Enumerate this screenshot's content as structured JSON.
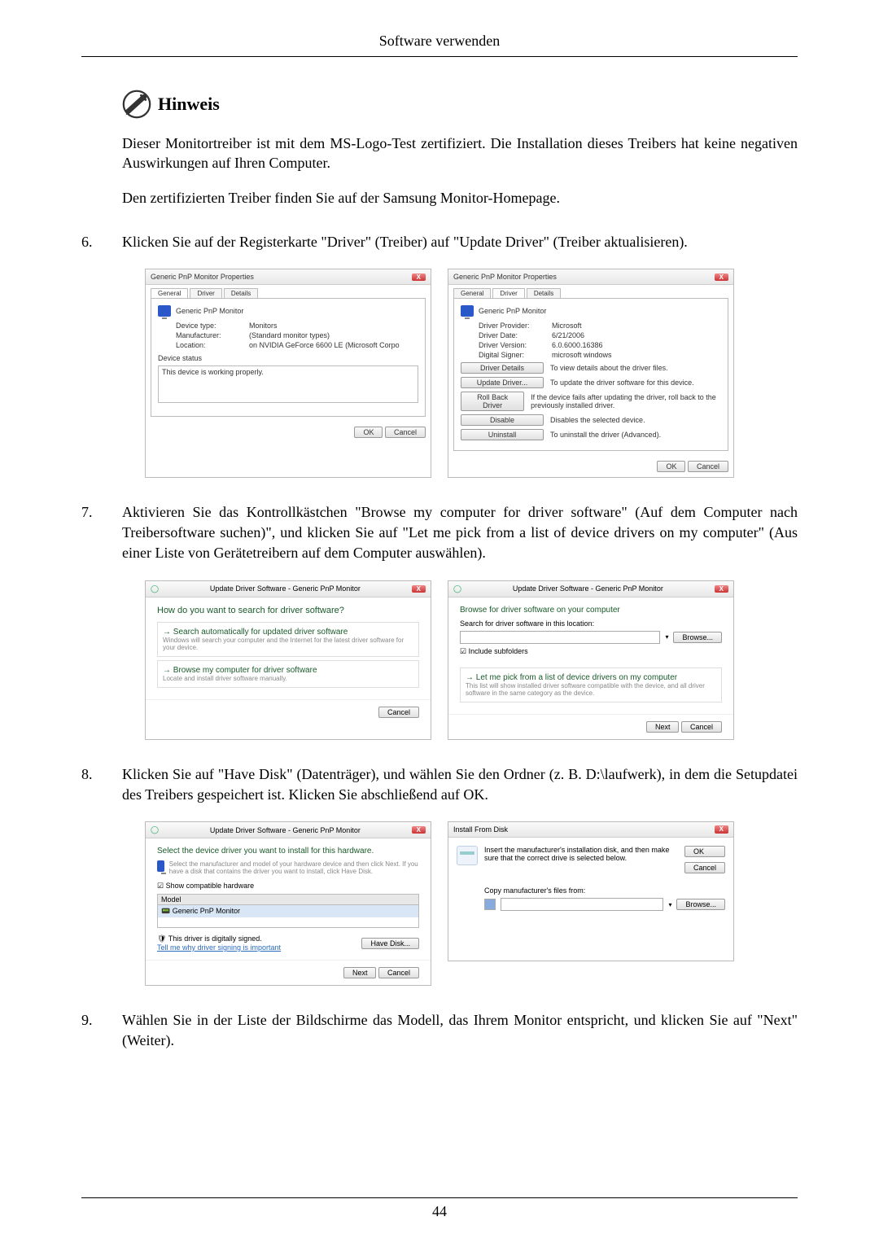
{
  "header": {
    "title": "Software verwenden"
  },
  "note": {
    "title": "Hinweis",
    "p1": "Dieser Monitortreiber ist mit dem MS-Logo-Test zertifiziert. Die Installation dieses Treibers hat keine negativen Auswirkungen auf Ihren Computer.",
    "p2": "Den zertifizierten Treiber finden Sie auf der Samsung Monitor-Homepage."
  },
  "steps": {
    "s6_num": "6.",
    "s6_text": "Klicken Sie auf der Registerkarte \"Driver\" (Treiber) auf \"Update Driver\" (Treiber aktualisieren).",
    "s7_num": "7.",
    "s7_text": "Aktivieren Sie das Kontrollkästchen \"Browse my computer for driver software\" (Auf dem Computer nach Treibersoftware suchen)\", und klicken Sie auf \"Let me pick from a list of device drivers on my computer\" (Aus einer Liste von Gerätetreibern auf dem Computer auswählen).",
    "s8_num": "8.",
    "s8_text": "Klicken Sie auf \"Have Disk\" (Datenträger), und wählen Sie den Ordner (z. B. D:\\laufwerk), in dem die Setupdatei des Treibers gespeichert ist. Klicken Sie abschließend auf OK.",
    "s9_num": "9.",
    "s9_text": "Wählen Sie in der Liste der Bildschirme das Modell, das Ihrem Monitor entspricht, und klicken Sie auf \"Next\" (Weiter)."
  },
  "dlg_props": {
    "title": "Generic PnP Monitor Properties",
    "tab_general": "General",
    "tab_driver": "Driver",
    "tab_details": "Details",
    "monitor_name": "Generic PnP Monitor",
    "g_dev_type_k": "Device type:",
    "g_dev_type_v": "Monitors",
    "g_mfr_k": "Manufacturer:",
    "g_mfr_v": "(Standard monitor types)",
    "g_loc_k": "Location:",
    "g_loc_v": "on NVIDIA GeForce 6600 LE (Microsoft Corpo",
    "g_status_k": "Device status",
    "g_status_v": "This device is working properly.",
    "d_provider_k": "Driver Provider:",
    "d_provider_v": "Microsoft",
    "d_date_k": "Driver Date:",
    "d_date_v": "6/21/2006",
    "d_version_k": "Driver Version:",
    "d_version_v": "6.0.6000.16386",
    "d_signer_k": "Digital Signer:",
    "d_signer_v": "microsoft windows",
    "btn_details": "Driver Details",
    "btn_details_t": "To view details about the driver files.",
    "btn_update": "Update Driver...",
    "btn_update_t": "To update the driver software for this device.",
    "btn_rollback": "Roll Back Driver",
    "btn_rollback_t": "If the device fails after updating the driver, roll back to the previously installed driver.",
    "btn_disable": "Disable",
    "btn_disable_t": "Disables the selected device.",
    "btn_uninstall": "Uninstall",
    "btn_uninstall_t": "To uninstall the driver (Advanced).",
    "btn_ok": "OK",
    "btn_cancel": "Cancel"
  },
  "dlg_update": {
    "title": "Update Driver Software - Generic PnP Monitor",
    "q": "How do you want to search for driver software?",
    "opt1_t": "Search automatically for updated driver software",
    "opt1_s": "Windows will search your computer and the Internet for the latest driver software for your device.",
    "opt2_t": "Browse my computer for driver software",
    "opt2_s": "Locate and install driver software manually.",
    "btn_cancel": "Cancel"
  },
  "dlg_browse": {
    "title": "Update Driver Software - Generic PnP Monitor",
    "h": "Browse for driver software on your computer",
    "lbl_search": "Search for driver software in this location:",
    "btn_browse": "Browse...",
    "chk_sub": "Include subfolders",
    "pick_t": "Let me pick from a list of device drivers on my computer",
    "pick_s": "This list will show installed driver software compatible with the device, and all driver software in the same category as the device.",
    "btn_next": "Next",
    "btn_cancel": "Cancel"
  },
  "dlg_select": {
    "title": "Update Driver Software - Generic PnP Monitor",
    "h": "Select the device driver you want to install for this hardware.",
    "sub": "Select the manufacturer and model of your hardware device and then click Next. If you have a disk that contains the driver you want to install, click Have Disk.",
    "chk_compat": "Show compatible hardware",
    "col_model": "Model",
    "row_model": "Generic PnP Monitor",
    "signed": "This driver is digitally signed.",
    "tell": "Tell me why driver signing is important",
    "btn_have": "Have Disk...",
    "btn_next": "Next",
    "btn_cancel": "Cancel"
  },
  "dlg_install": {
    "title": "Install From Disk",
    "msg": "Insert the manufacturer's installation disk, and then make sure that the correct drive is selected below.",
    "copy": "Copy manufacturer's files from:",
    "btn_ok": "OK",
    "btn_cancel": "Cancel",
    "btn_browse": "Browse..."
  },
  "page_num": "44"
}
